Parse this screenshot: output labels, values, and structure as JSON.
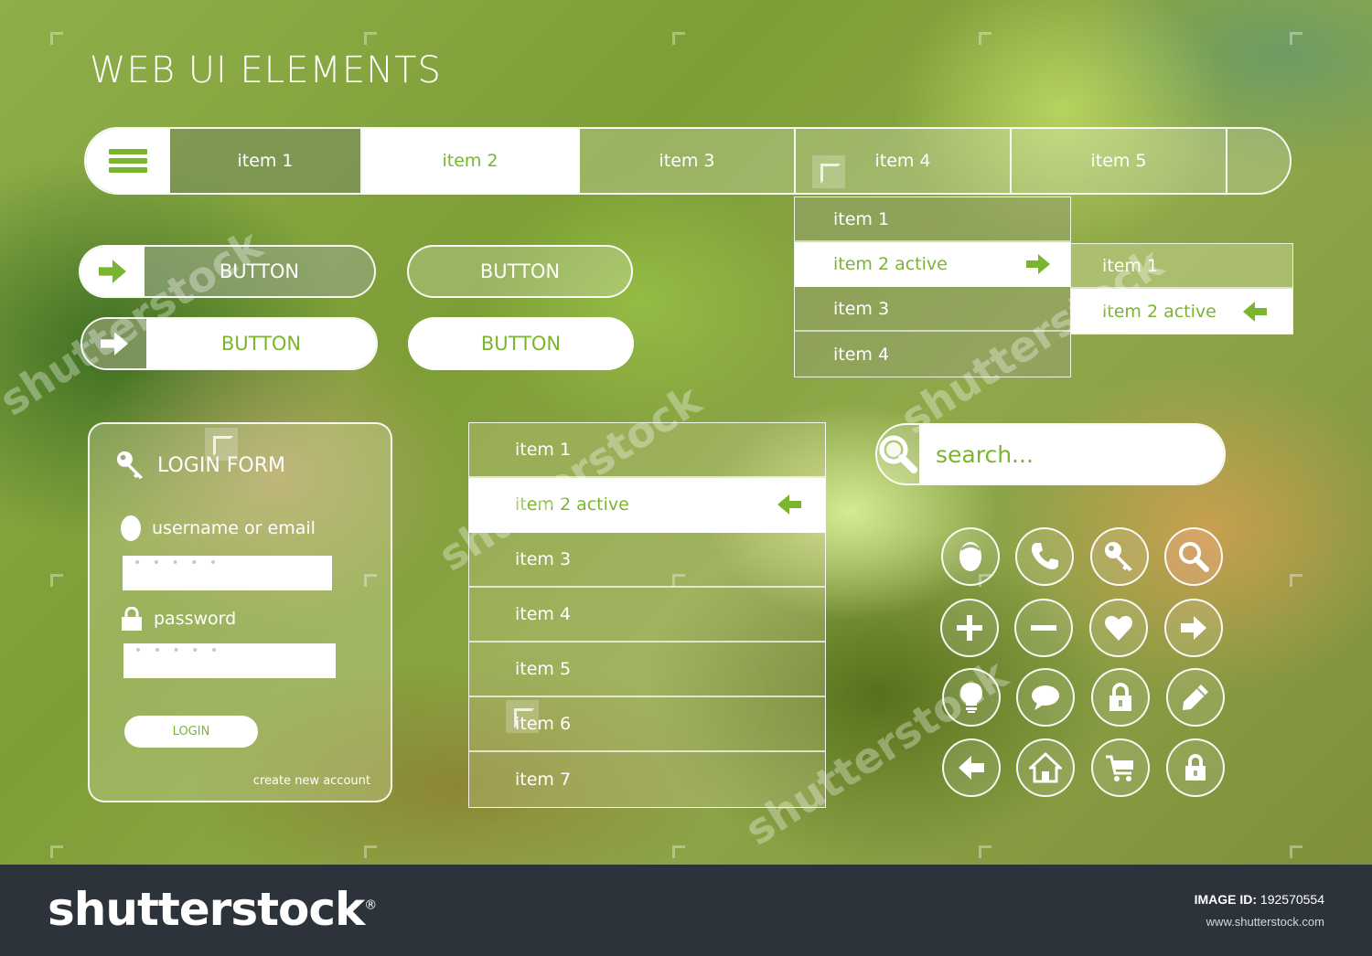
{
  "page_title": "WEB UI ELEMENTS",
  "colors": {
    "accent": "#7bb530",
    "white": "#ffffff",
    "footer_bg": "#2d333b"
  },
  "nav": {
    "menu_icon": "hamburger-icon",
    "items": [
      "item 1",
      "item 2",
      "item 3",
      "item 4",
      "item 5"
    ],
    "active_index": 1
  },
  "dropdown": {
    "items": [
      "item 1",
      "item 2 active",
      "item 3",
      "item 4"
    ],
    "active_index": 1,
    "submenu": {
      "items": [
        "item 1",
        "item 2 active"
      ],
      "active_index": 1
    }
  },
  "buttons": [
    {
      "label": "BUTTON",
      "icon": "arrow-right-icon"
    },
    {
      "label": "BUTTON"
    },
    {
      "label": "BUTTON",
      "icon": "arrow-right-icon"
    },
    {
      "label": "BUTTON"
    }
  ],
  "login_form": {
    "title": "LOGIN FORM",
    "title_icon": "key-icon",
    "username_label": "username or email",
    "username_icon": "user-icon",
    "username_value": "• • • • •",
    "password_label": "password",
    "password_icon": "lock-icon",
    "password_value": "• • • • •",
    "submit_label": "LOGIN",
    "create_link": "create new account"
  },
  "vertical_list": {
    "items": [
      "item 1",
      "item 2 active",
      "item 3",
      "item 4",
      "item 5",
      "item 6",
      "item 7"
    ],
    "active_index": 1
  },
  "search": {
    "placeholder": "search...",
    "icon": "search-icon"
  },
  "icon_grid": [
    "user-icon",
    "phone-icon",
    "key-icon",
    "search-icon",
    "plus-icon",
    "minus-icon",
    "heart-icon",
    "arrow-right-icon",
    "lightbulb-icon",
    "chat-bubble-icon",
    "lock-icon",
    "pencil-icon",
    "arrow-left-icon",
    "home-icon",
    "cart-icon",
    "lock-icon"
  ],
  "watermark": {
    "text": "shutterstock"
  },
  "footer": {
    "brand": "shutterstock",
    "image_id_label": "IMAGE ID:",
    "image_id": "192570554",
    "site": "www.shutterstock.com"
  }
}
